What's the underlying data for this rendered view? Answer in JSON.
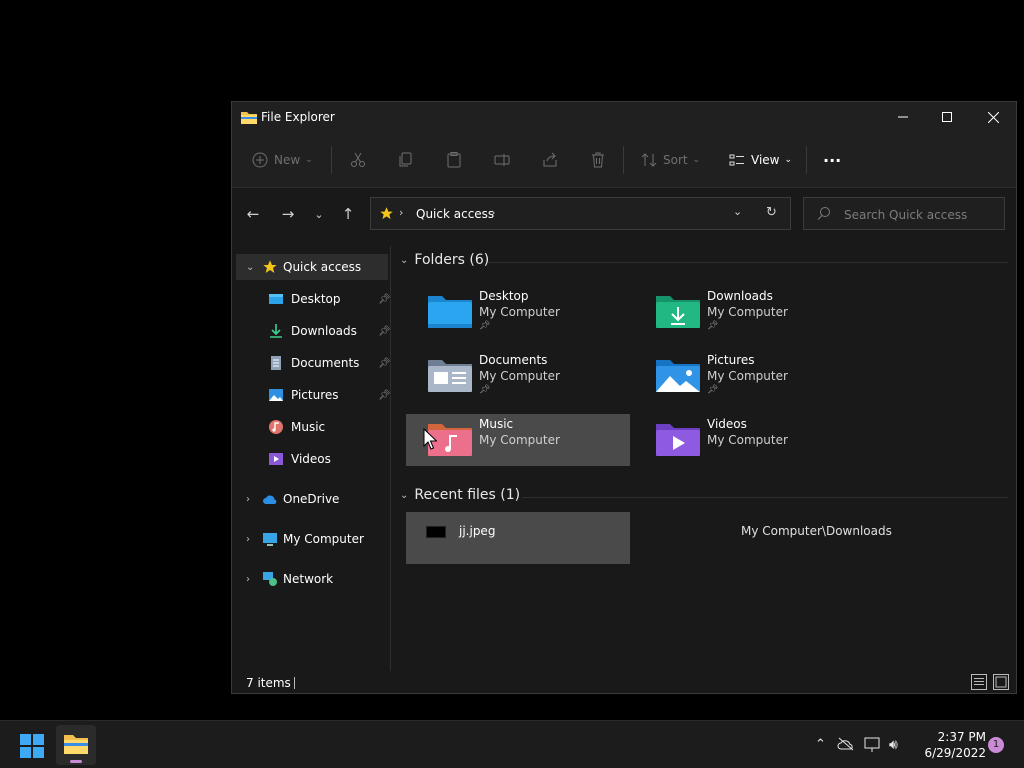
{
  "window": {
    "title": "File Explorer",
    "minimize_icon": "minimize-icon",
    "maximize_icon": "maximize-icon",
    "close_icon": "close-icon"
  },
  "toolbar": {
    "new_label": "New",
    "sort_label": "Sort",
    "view_label": "View",
    "more_label": "···"
  },
  "address": {
    "location": "Quick access",
    "sep": "›"
  },
  "search": {
    "placeholder": "Search Quick access"
  },
  "sidebar": {
    "quick_access": "Quick access",
    "items": [
      {
        "label": "Desktop",
        "pinned": true
      },
      {
        "label": "Downloads",
        "pinned": true
      },
      {
        "label": "Documents",
        "pinned": true
      },
      {
        "label": "Pictures",
        "pinned": true
      },
      {
        "label": "Music",
        "pinned": false
      },
      {
        "label": "Videos",
        "pinned": false
      }
    ],
    "onedrive": "OneDrive",
    "my_computer": "My Computer",
    "network": "Network"
  },
  "content": {
    "folders_header": "Folders (6)",
    "folders": [
      {
        "name": "Desktop",
        "location": "My Computer",
        "pinned": true
      },
      {
        "name": "Downloads",
        "location": "My Computer",
        "pinned": true
      },
      {
        "name": "Documents",
        "location": "My Computer",
        "pinned": true
      },
      {
        "name": "Pictures",
        "location": "My Computer",
        "pinned": true
      },
      {
        "name": "Music",
        "location": "My Computer",
        "pinned": false
      },
      {
        "name": "Videos",
        "location": "My Computer",
        "pinned": false
      }
    ],
    "recent_header": "Recent files (1)",
    "recent": [
      {
        "name": "jj.jpeg",
        "location": "My Computer\\Downloads"
      }
    ]
  },
  "status": {
    "items_count": "7 items"
  },
  "taskbar": {
    "time": "2:37 PM",
    "date": "6/29/2022",
    "notifications": "1"
  },
  "colors": {
    "accent": "#3fa9f5",
    "window_bg": "#191919",
    "hover": "#4a4a4a",
    "notification": "#c98ad6"
  }
}
